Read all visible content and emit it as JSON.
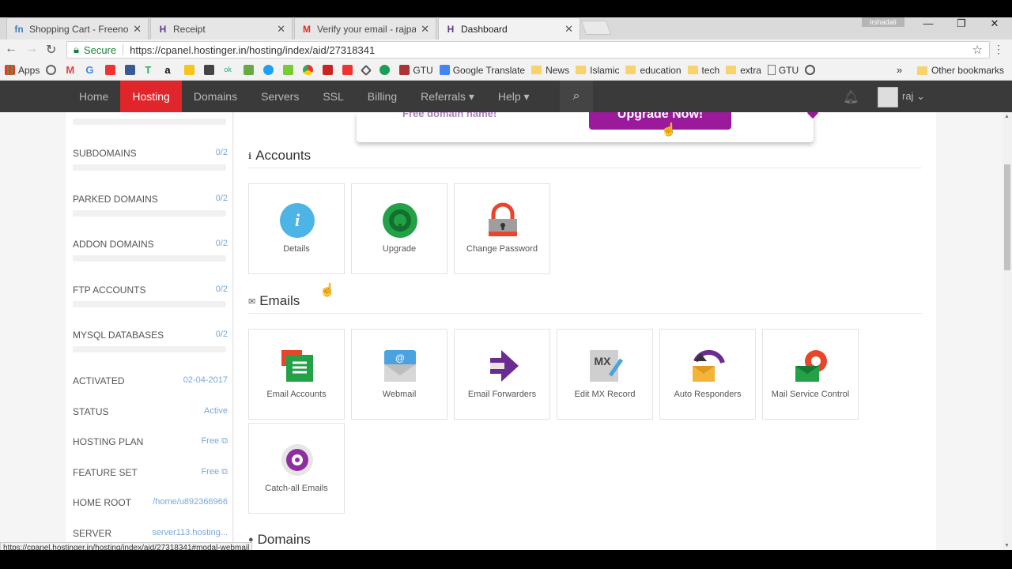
{
  "browser": {
    "tabs": [
      {
        "title": "Shopping Cart - Freenom",
        "favicon": "fn",
        "color": "#3b82c4"
      },
      {
        "title": "Receipt",
        "favicon": "H",
        "color": "#5f3c8f"
      },
      {
        "title": "Verify your email - rajpat",
        "favicon": "M",
        "color": "#d93025"
      },
      {
        "title": "Dashboard",
        "favicon": "H",
        "color": "#5f3c8f",
        "active": true
      }
    ],
    "profile_badge": "irshadali",
    "secure_label": "Secure",
    "url": "https://cpanel.hostinger.in/hosting/index/aid/27318341",
    "bookmarks": [
      {
        "label": "Apps",
        "icon": "apps-icon"
      },
      {
        "label": "",
        "icon": "history-icon"
      },
      {
        "label": "",
        "icon": "gmail-icon"
      },
      {
        "label": "",
        "icon": "google-icon"
      },
      {
        "label": "",
        "icon": "youtube-icon"
      },
      {
        "label": "",
        "icon": "facebook-icon"
      },
      {
        "label": "",
        "icon": "translate-icon"
      },
      {
        "label": "",
        "icon": "amazon-icon"
      },
      {
        "label": "",
        "icon": "pencil-icon"
      },
      {
        "label": "",
        "icon": "gift-icon"
      },
      {
        "label": "",
        "icon": "olx-icon"
      },
      {
        "label": "",
        "icon": "chart-icon"
      },
      {
        "label": "",
        "icon": "twitter-icon"
      },
      {
        "label": "",
        "icon": "download-icon"
      },
      {
        "label": "",
        "icon": "chrome-icon"
      },
      {
        "label": "",
        "icon": "play-icon"
      },
      {
        "label": "",
        "icon": "youtube-icon"
      },
      {
        "label": "",
        "icon": "diamond-icon"
      },
      {
        "label": "",
        "icon": "hangouts-icon"
      },
      {
        "label": "GTU",
        "icon": "gtu-icon"
      },
      {
        "label": "Google Translate",
        "icon": "translate-icon"
      },
      {
        "label": "News",
        "icon": "folder-icon"
      },
      {
        "label": "Islamic",
        "icon": "folder-icon"
      },
      {
        "label": "education",
        "icon": "folder-icon"
      },
      {
        "label": "tech",
        "icon": "folder-icon"
      },
      {
        "label": "extra",
        "icon": "folder-icon"
      },
      {
        "label": "GTU",
        "icon": "page-icon"
      }
    ],
    "more_bookmarks": "»",
    "other_bookmarks": "Other bookmarks",
    "status_url": "https://cpanel.hostinger.in/hosting/index/aid/27318341#modal-webmail"
  },
  "site_nav": {
    "items": [
      "Home",
      "Hosting",
      "Domains",
      "Servers",
      "SSL",
      "Billing",
      "Referrals ▾",
      "Help ▾"
    ],
    "active": "Hosting",
    "username": "raj"
  },
  "banner": {
    "text": "Free domain name!",
    "button": "Upgrade Now!"
  },
  "sidebar": {
    "rows": [
      {
        "label": "SUBDOMAINS",
        "value": "0/2"
      },
      {
        "label": "PARKED DOMAINS",
        "value": "0/2"
      },
      {
        "label": "ADDON DOMAINS",
        "value": "0/2"
      },
      {
        "label": "FTP ACCOUNTS",
        "value": "0/2"
      },
      {
        "label": "MYSQL DATABASES",
        "value": "0/2"
      },
      {
        "label": "ACTIVATED",
        "value": "02-04-2017"
      },
      {
        "label": "STATUS",
        "value": "Active"
      },
      {
        "label": "HOSTING PLAN",
        "value": "Free"
      },
      {
        "label": "FEATURE SET",
        "value": "Free"
      },
      {
        "label": "HOME ROOT",
        "value": "/home/u892366966"
      },
      {
        "label": "SERVER",
        "value": "server113.hosting..."
      }
    ]
  },
  "sections": {
    "accounts": {
      "title": "Accounts",
      "items": [
        "Details",
        "Upgrade",
        "Change Password"
      ]
    },
    "emails": {
      "title": "Emails",
      "items": [
        "Email Accounts",
        "Webmail",
        "Email Forwarders",
        "Edit MX Record",
        "Auto Responders",
        "Mail Service Control",
        "Catch-all Emails"
      ]
    },
    "domains": {
      "title": "Domains"
    }
  }
}
